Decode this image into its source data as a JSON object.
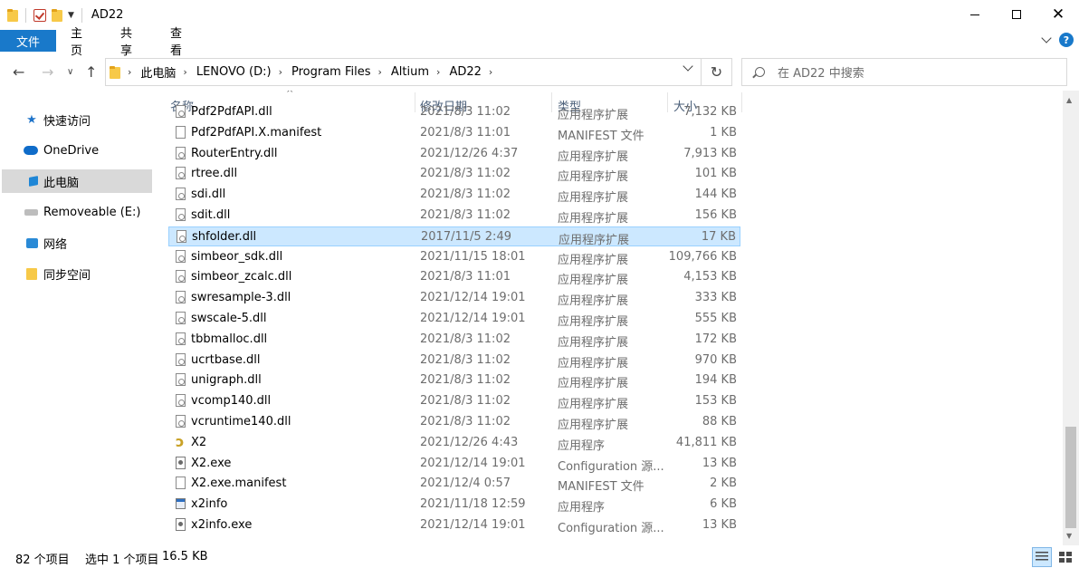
{
  "window": {
    "title": "AD22"
  },
  "ribbon": {
    "tabs": [
      "文件",
      "主页",
      "共享",
      "查看"
    ]
  },
  "address": {
    "crumbs": [
      "此电脑",
      "LENOVO (D:)",
      "Program Files",
      "Altium",
      "AD22"
    ]
  },
  "search": {
    "placeholder": "在 AD22 中搜索"
  },
  "sidebar": {
    "items": [
      {
        "label": "快速访问",
        "icon": "star-icon"
      },
      {
        "label": "OneDrive",
        "icon": "cloud-icon"
      },
      {
        "label": "此电脑",
        "icon": "computer-icon",
        "selected": true
      },
      {
        "label": "Removeable (E:)",
        "icon": "drive-icon"
      },
      {
        "label": "网络",
        "icon": "network-icon"
      },
      {
        "label": "同步空间",
        "icon": "folder-icon"
      }
    ]
  },
  "columns": {
    "name": "名称",
    "date": "修改日期",
    "type": "类型",
    "size": "大小"
  },
  "files": [
    {
      "name": "Pdf2PdfAPI.dll",
      "date": "2021/8/3 11:02",
      "type": "应用程序扩展",
      "size": "7,132 KB",
      "icon": "dll"
    },
    {
      "name": "Pdf2PdfAPI.X.manifest",
      "date": "2021/8/3 11:01",
      "type": "MANIFEST 文件",
      "size": "1 KB",
      "icon": "file"
    },
    {
      "name": "RouterEntry.dll",
      "date": "2021/12/26 4:37",
      "type": "应用程序扩展",
      "size": "7,913 KB",
      "icon": "dll"
    },
    {
      "name": "rtree.dll",
      "date": "2021/8/3 11:02",
      "type": "应用程序扩展",
      "size": "101 KB",
      "icon": "dll"
    },
    {
      "name": "sdi.dll",
      "date": "2021/8/3 11:02",
      "type": "应用程序扩展",
      "size": "144 KB",
      "icon": "dll"
    },
    {
      "name": "sdit.dll",
      "date": "2021/8/3 11:02",
      "type": "应用程序扩展",
      "size": "156 KB",
      "icon": "dll"
    },
    {
      "name": "shfolder.dll",
      "date": "2017/11/5 2:49",
      "type": "应用程序扩展",
      "size": "17 KB",
      "icon": "dll",
      "selected": true
    },
    {
      "name": "simbeor_sdk.dll",
      "date": "2021/11/15 18:01",
      "type": "应用程序扩展",
      "size": "109,766 KB",
      "icon": "dll"
    },
    {
      "name": "simbeor_zcalc.dll",
      "date": "2021/8/3 11:01",
      "type": "应用程序扩展",
      "size": "4,153 KB",
      "icon": "dll"
    },
    {
      "name": "swresample-3.dll",
      "date": "2021/12/14 19:01",
      "type": "应用程序扩展",
      "size": "333 KB",
      "icon": "dll"
    },
    {
      "name": "swscale-5.dll",
      "date": "2021/12/14 19:01",
      "type": "应用程序扩展",
      "size": "555 KB",
      "icon": "dll"
    },
    {
      "name": "tbbmalloc.dll",
      "date": "2021/8/3 11:02",
      "type": "应用程序扩展",
      "size": "172 KB",
      "icon": "dll"
    },
    {
      "name": "ucrtbase.dll",
      "date": "2021/8/3 11:02",
      "type": "应用程序扩展",
      "size": "970 KB",
      "icon": "dll"
    },
    {
      "name": "unigraph.dll",
      "date": "2021/8/3 11:02",
      "type": "应用程序扩展",
      "size": "194 KB",
      "icon": "dll"
    },
    {
      "name": "vcomp140.dll",
      "date": "2021/8/3 11:02",
      "type": "应用程序扩展",
      "size": "153 KB",
      "icon": "dll"
    },
    {
      "name": "vcruntime140.dll",
      "date": "2021/8/3 11:02",
      "type": "应用程序扩展",
      "size": "88 KB",
      "icon": "dll"
    },
    {
      "name": "X2",
      "date": "2021/12/26 4:43",
      "type": "应用程序",
      "size": "41,811 KB",
      "icon": "x2"
    },
    {
      "name": "X2.exe",
      "date": "2021/12/14 19:01",
      "type": "Configuration 源...",
      "size": "13 KB",
      "icon": "exe"
    },
    {
      "name": "X2.exe.manifest",
      "date": "2021/12/4 0:57",
      "type": "MANIFEST 文件",
      "size": "2 KB",
      "icon": "file"
    },
    {
      "name": "x2info",
      "date": "2021/11/18 12:59",
      "type": "应用程序",
      "size": "6 KB",
      "icon": "app"
    },
    {
      "name": "x2info.exe",
      "date": "2021/12/14 19:01",
      "type": "Configuration 源...",
      "size": "13 KB",
      "icon": "exe"
    }
  ],
  "status": {
    "count": "82 个项目",
    "selection": "选中 1 个项目",
    "size": "16.5 KB"
  },
  "colors": {
    "accent": "#1979ca",
    "selection": "#cce8ff",
    "selection_border": "#99d1ff"
  }
}
